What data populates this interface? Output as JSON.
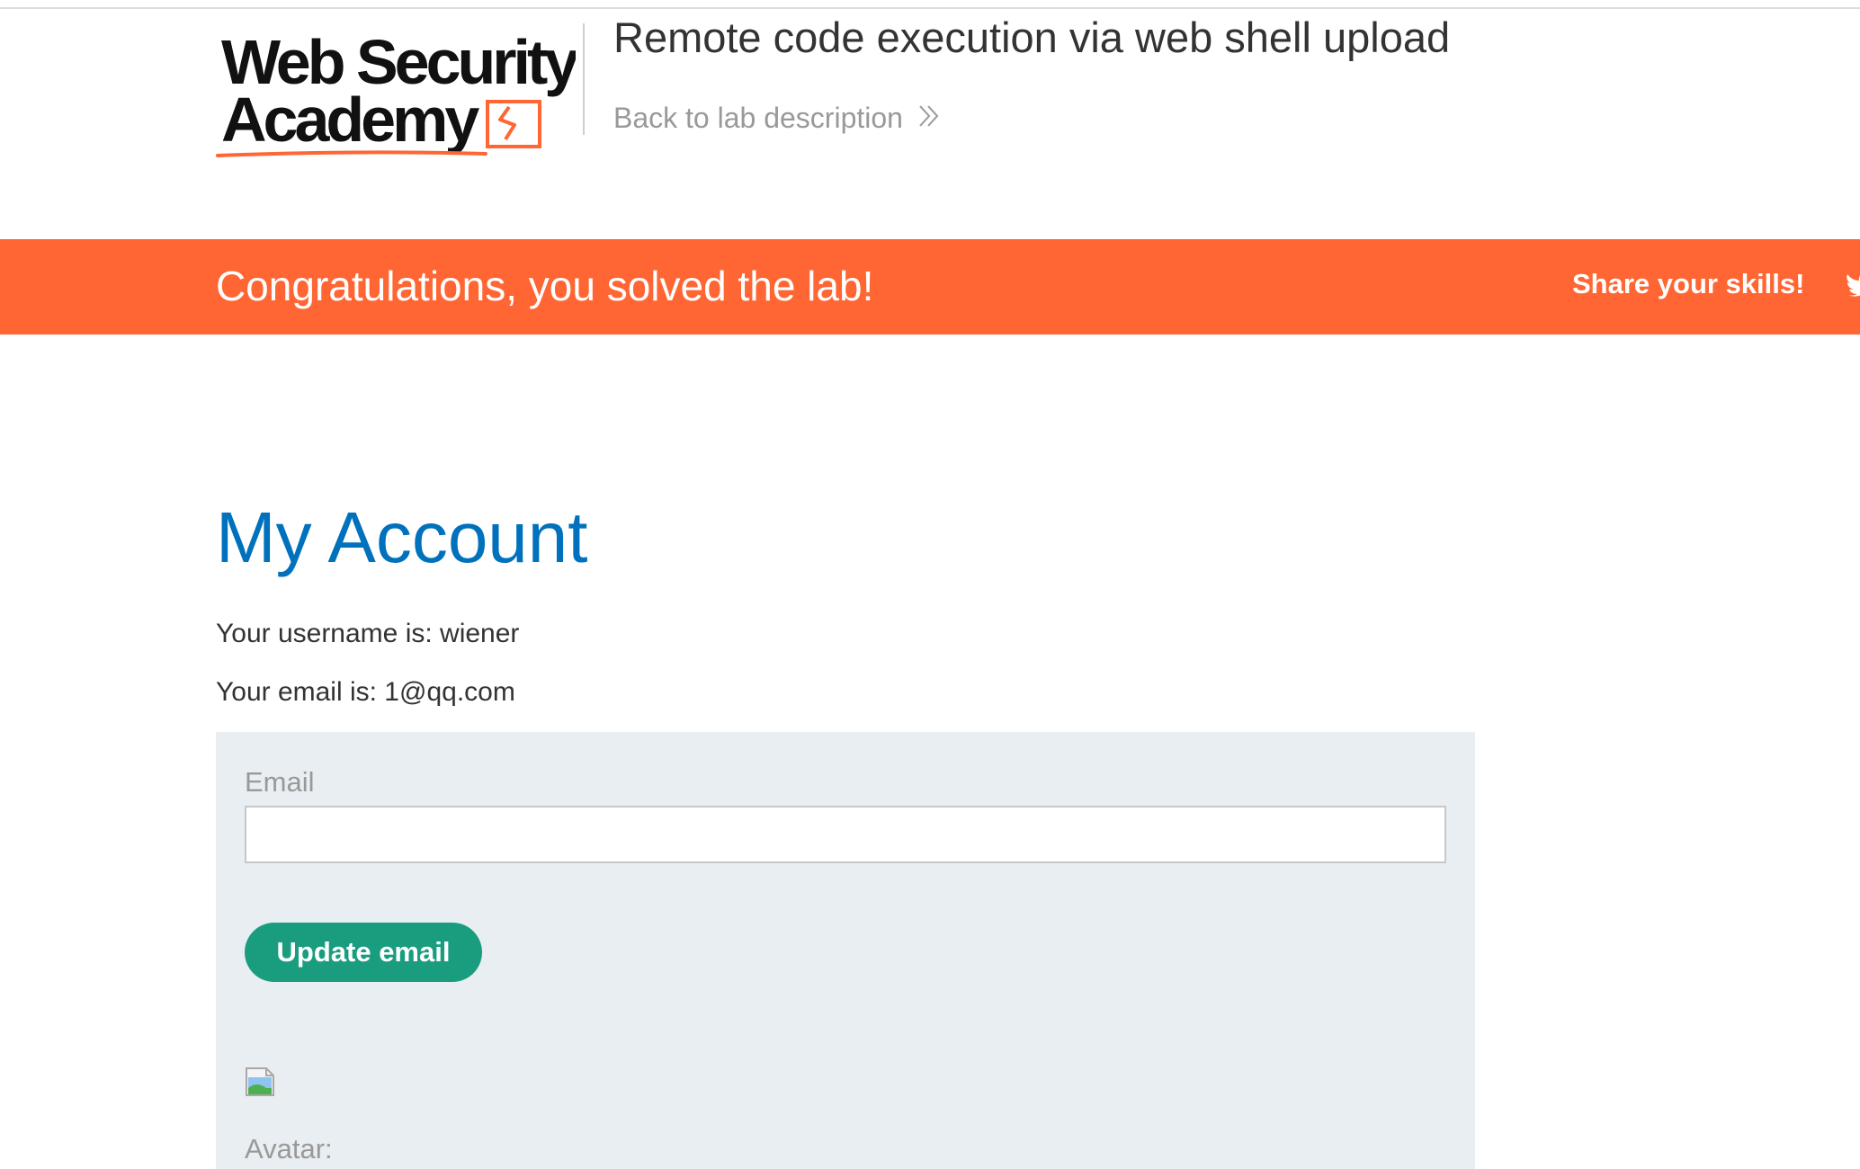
{
  "header": {
    "logo_line1": "Web Security",
    "logo_line2": "Academy",
    "lab_title": "Remote code execution via web shell upload",
    "back_link": "Back to lab description"
  },
  "banner": {
    "message": "Congratulations, you solved the lab!",
    "share_label": "Share your skills!"
  },
  "main": {
    "title": "My Account",
    "username_line": "Your username is: wiener",
    "email_line": "Your email is: 1@qq.com"
  },
  "form": {
    "email_label": "Email",
    "email_value": "",
    "update_button": "Update email",
    "avatar_label": "Avatar:"
  },
  "colors": {
    "accent_orange": "#ff6633",
    "title_blue": "#0071bc",
    "button_green": "#1a9d7f",
    "panel_bg": "#e8eef1"
  },
  "icons": {
    "back": "double-chevron-right-icon",
    "share": "twitter-icon",
    "avatar": "broken-image-icon"
  }
}
